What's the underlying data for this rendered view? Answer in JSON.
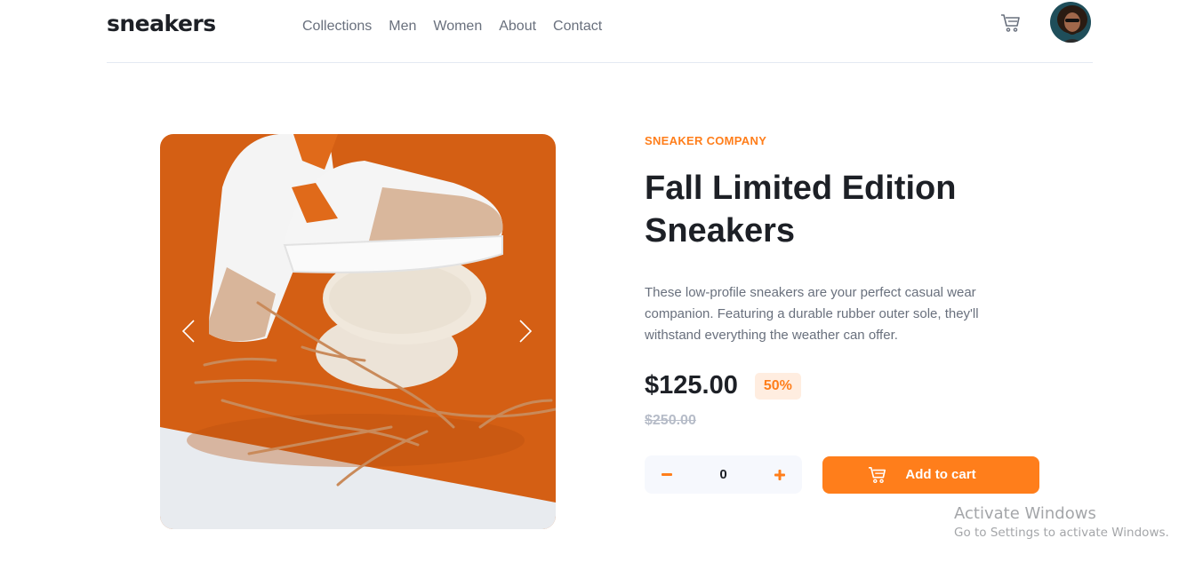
{
  "header": {
    "logo": "sneakers",
    "nav": [
      "Collections",
      "Men",
      "Women",
      "About",
      "Contact"
    ],
    "cart_icon": "cart-icon",
    "avatar_icon": "user-avatar"
  },
  "product": {
    "company": "SNEAKER COMPANY",
    "title_line1": "Fall Limited Edition",
    "title_line2": "Sneakers",
    "description": "These low-profile sneakers are your perfect casual wear companion. Featuring a durable rubber outer sole, they'll withstand everything the weather can offer.",
    "price": "$125.00",
    "discount": "50%",
    "original_price": "$250.00",
    "quantity": "0",
    "add_to_cart": "Add to cart"
  },
  "gallery": {
    "prev_icon": "chevron-left-icon",
    "next_icon": "chevron-right-icon"
  },
  "colors": {
    "accent": "#ff7e1b",
    "accent_light": "#ffede0",
    "text_dark": "#1d2026",
    "text_grey": "#69707d"
  },
  "watermark": {
    "title": "Activate Windows",
    "subtitle": "Go to Settings to activate Windows."
  }
}
